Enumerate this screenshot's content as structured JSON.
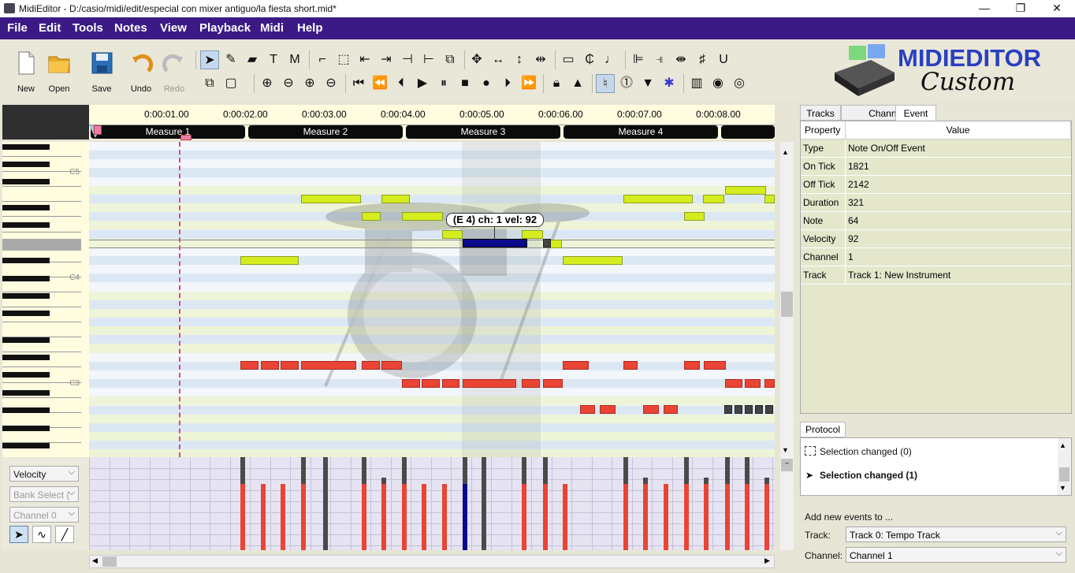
{
  "window": {
    "title": "MidiEditor - D:/casio/midi/edit/especial con mixer antiguo/la fiesta short.mid*",
    "minimize": "—",
    "maximize": "❐",
    "close": "✕"
  },
  "menu": [
    "File",
    "Edit",
    "Tools",
    "Notes",
    "View",
    "Playback",
    "Midi",
    "Help"
  ],
  "toolbar": {
    "new": "New",
    "open": "Open",
    "save": "Save",
    "undo": "Undo",
    "redo": "Redo"
  },
  "logo": {
    "line1": "MIDIEDITOR",
    "line2": "Custom"
  },
  "timeline": {
    "ticks": [
      "0:00:01.00",
      "0:00:02.00",
      "0:00:03.00",
      "0:00:04.00",
      "0:00:05.00",
      "0:00:06.00",
      "0:00:07.00",
      "0:00:08.00"
    ],
    "measures": [
      "Measure 1",
      "Measure 2",
      "Measure 3",
      "Measure 4"
    ]
  },
  "piano": {
    "labels": [
      "C5",
      "C4",
      "C3"
    ]
  },
  "tooltip": "(E 4) ch: 1 vel: 92",
  "misc": {
    "mode": "Velocity",
    "control": "Bank Select (",
    "channel": "Channel 0"
  },
  "right": {
    "tabs": [
      "Tracks",
      "Channels",
      "Event"
    ],
    "table_headers": {
      "property": "Property",
      "value": "Value"
    },
    "event_rows": [
      {
        "property": "Type",
        "value": "Note On/Off Event"
      },
      {
        "property": "On Tick",
        "value": "1821"
      },
      {
        "property": "Off Tick",
        "value": "2142"
      },
      {
        "property": "Duration",
        "value": "321"
      },
      {
        "property": "Note",
        "value": "64"
      },
      {
        "property": "Velocity",
        "value": "92"
      },
      {
        "property": "Channel",
        "value": "1"
      },
      {
        "property": "Track",
        "value": "Track 1: New Instrument"
      }
    ],
    "protocol_tab": "Protocol",
    "protocol": [
      "Selection changed (0)",
      "Selection changed (1)"
    ],
    "add_events": {
      "title": "Add new events to ...",
      "track_label": "Track:",
      "track_value": "Track 0: Tempo Track",
      "channel_label": "Channel:",
      "channel_value": "Channel 1"
    }
  },
  "colors": {
    "menubar": "#3b1a86",
    "note_yellow": "#d5ec1e",
    "note_red": "#ea4434",
    "note_selected": "#0a0a8a",
    "logo_blue": "#2a3fc0"
  }
}
